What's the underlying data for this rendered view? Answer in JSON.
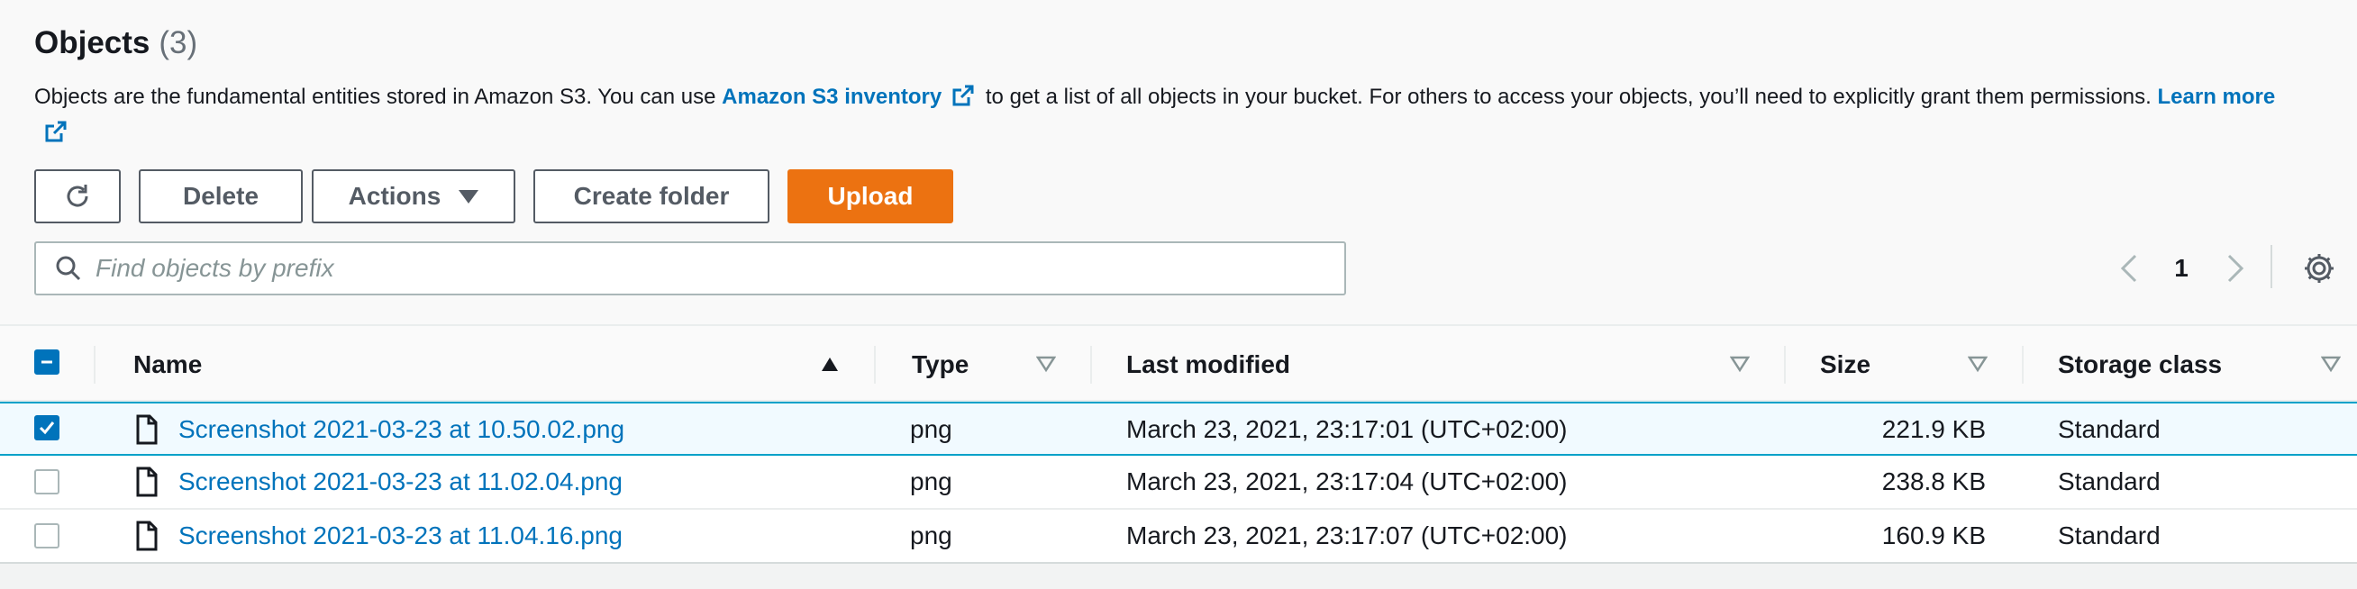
{
  "header": {
    "title": "Objects",
    "count": "(3)",
    "desc_part1": "Objects are the fundamental entities stored in Amazon S3. You can use ",
    "inventory_link": "Amazon S3 inventory",
    "desc_part2": " to get a list of all objects in your bucket. For others to access your objects, you’ll need to explicitly grant them permissions. ",
    "learn_more": "Learn more"
  },
  "toolbar": {
    "refresh_icon": "refresh-icon",
    "delete_label": "Delete",
    "actions_label": "Actions",
    "create_folder_label": "Create folder",
    "upload_label": "Upload",
    "upload_color": "#ec7211"
  },
  "search": {
    "placeholder": "Find objects by prefix",
    "value": ""
  },
  "pagination": {
    "current_page": "1"
  },
  "table": {
    "columns": {
      "name": "Name",
      "type": "Type",
      "last_modified": "Last modified",
      "size": "Size",
      "storage_class": "Storage class"
    },
    "header_checkbox_state": "indeterminate",
    "rows": [
      {
        "selected": true,
        "name": "Screenshot 2021-03-23 at 10.50.02.png",
        "type": "png",
        "last_modified": "March 23, 2021, 23:17:01 (UTC+02:00)",
        "size": "221.9 KB",
        "storage_class": "Standard"
      },
      {
        "selected": false,
        "name": "Screenshot 2021-03-23 at 11.02.04.png",
        "type": "png",
        "last_modified": "March 23, 2021, 23:17:04 (UTC+02:00)",
        "size": "238.8 KB",
        "storage_class": "Standard"
      },
      {
        "selected": false,
        "name": "Screenshot 2021-03-23 at 11.04.16.png",
        "type": "png",
        "last_modified": "March 23, 2021, 23:17:07 (UTC+02:00)",
        "size": "160.9 KB",
        "storage_class": "Standard"
      }
    ]
  },
  "colors": {
    "link": "#0073bb",
    "selection_border": "#00a1c9",
    "selection_bg": "#f1faff"
  }
}
